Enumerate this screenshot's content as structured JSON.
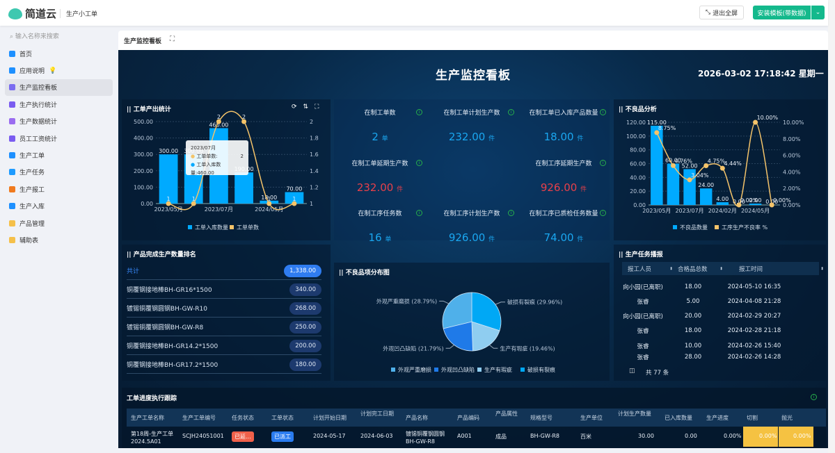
{
  "header": {
    "logo_text": "简道云",
    "app_name": "生产小工单",
    "exit_fullscreen": "退出全屏",
    "install_template": "安装模板(带数据)"
  },
  "sidebar": {
    "search_placeholder": "输入名称来搜索",
    "items": [
      {
        "label": "首页",
        "icon": "home-icon",
        "color": "#1e90ff"
      },
      {
        "label": "应用说明",
        "icon": "doc-icon",
        "color": "#1e90ff"
      },
      {
        "label": "生产监控看板",
        "icon": "home-icon",
        "color": "#7a6cf0",
        "active": true
      },
      {
        "label": "生产执行统计",
        "icon": "chart-icon",
        "color": "#7a5cf0"
      },
      {
        "label": "生产数据统计",
        "icon": "chart-icon",
        "color": "#9a6cf0"
      },
      {
        "label": "员工工资统计",
        "icon": "home-icon",
        "color": "#7a5cf0"
      },
      {
        "label": "生产工单",
        "icon": "doc-icon",
        "color": "#1e90ff"
      },
      {
        "label": "生产任务",
        "icon": "circle-icon",
        "color": "#1e9bff"
      },
      {
        "label": "生产报工",
        "icon": "send-icon",
        "color": "#f07a1e"
      },
      {
        "label": "生产入库",
        "icon": "form-icon",
        "color": "#1e90ff"
      },
      {
        "label": "产品管理",
        "icon": "folder-icon",
        "color": "#f5c04a"
      },
      {
        "label": "辅助表",
        "icon": "folder-icon",
        "color": "#f5c04a"
      }
    ]
  },
  "tab": {
    "label": "生产监控看板"
  },
  "dashboard": {
    "title": "生产监控看板",
    "datetime": "2026-03-02 17:18:42 星期一"
  },
  "chart1_panel": {
    "title": "工单产出统计",
    "tooltip": {
      "title": "2023/07月",
      "line1_label": "工单单数:",
      "line1_value": "2",
      "line2": "工单入库数量:460.00"
    }
  },
  "chart2_panel": {
    "title": "不良品分析"
  },
  "kpis": [
    {
      "label": "在制工单数",
      "value": "2",
      "unit": "单",
      "color": "#1aa7f0"
    },
    {
      "label": "在制工单计划生产数",
      "value": "232.00",
      "unit": "件",
      "color": "#1aa7f0"
    },
    {
      "label": "在制工单已入库产品数量",
      "value": "18.00",
      "unit": "件",
      "color": "#1aa7f0"
    },
    {
      "label": "在制工单延期生产数",
      "value": "232.00",
      "unit": "件",
      "color": "#e8404a"
    },
    {
      "label": "在制工序延期生产数",
      "value": "926.00",
      "unit": "件",
      "color": "#e8404a"
    },
    {
      "label": "在制工序任务数",
      "value": "16",
      "unit": "单",
      "color": "#1aa7f0"
    },
    {
      "label": "在制工序计划生产数",
      "value": "926.00",
      "unit": "件",
      "color": "#1aa7f0"
    },
    {
      "label": "在制工序已质检任务数量",
      "value": "74.00",
      "unit": "件",
      "color": "#1aa7f0"
    }
  ],
  "ranking": {
    "title": "产品完成生产数量排名",
    "total_label": "共计",
    "total_value": "1,338.00",
    "rows": [
      {
        "name": "铜覆钢接地棒BH-GR16*1500",
        "value": "340.00"
      },
      {
        "name": "镀锡铜覆钢圆钢BH-GW-R10",
        "value": "268.00"
      },
      {
        "name": "镀锡铜覆钢圆钢BH-GW-R8",
        "value": "250.00"
      },
      {
        "name": "铜覆钢接地棒BH-GR14.2*1500",
        "value": "200.00"
      },
      {
        "name": "铜覆钢接地棒BH-GR17.2*1500",
        "value": "180.00"
      }
    ]
  },
  "report": {
    "title": "生产任务播报",
    "columns": [
      "报工人员",
      "合格品总数",
      "报工时间"
    ],
    "rows": [
      [
        "向小园(已离职)",
        "18.00",
        "2024-05-10 16:35"
      ],
      [
        "张睿",
        "5.00",
        "2024-04-08 21:28"
      ],
      [
        "向小园(已离职)",
        "20.00",
        "2024-02-29 20:27"
      ],
      [
        "张睿",
        "18.00",
        "2024-02-28 21:18"
      ],
      [
        "张睿",
        "10.00",
        "2024-02-26 15:40"
      ],
      [
        "张睿",
        "28.00",
        "2024-02-26 14:28"
      ]
    ],
    "total": "共 77 条"
  },
  "table": {
    "title": "工单进度执行跟踪",
    "columns": [
      "生产工单名称",
      "生产工单编号",
      "任务状态",
      "工单状态",
      "计划开始日期",
      "计划完工日期",
      "产品名称",
      "产品编码",
      "产品属性",
      "规格型号",
      "生产单位",
      "计划生产数量",
      "已入库数量",
      "生产进度",
      "切割",
      "抛光"
    ],
    "row": {
      "name1": "第18周-生产工单",
      "name2": "2024.5A01",
      "code": "SCJH24051001",
      "task_status": "已延...",
      "order_status": "已派工",
      "start": "2024-05-17",
      "end": "2024-06-03",
      "product1": "镀锡铜覆钢圆钢",
      "product2": "BH-GW-R8",
      "product_code": "A001",
      "attr": "成品",
      "spec": "BH-GW-R8",
      "unit": "百米",
      "plan_qty": "30.00",
      "stored_qty": "0.00",
      "progress": "0.00%",
      "cut": "0.00%",
      "polish": "0.00%"
    },
    "status_colors": {
      "delayed": "#f0604a",
      "dispatched": "#2a7cf0"
    }
  },
  "chart_data": [
    {
      "type": "bar+line",
      "title": "工单产出统计",
      "categories": [
        "2023/05月",
        "",
        "2023/07月",
        "",
        "2024/05月",
        ""
      ],
      "series": [
        {
          "name": "工单入库数量",
          "type": "bar",
          "axis": "left",
          "values": [
            300,
            300,
            460,
            190,
            18,
            70
          ],
          "color": "#00aaff"
        },
        {
          "name": "工单单数",
          "type": "line",
          "axis": "right",
          "values": [
            1,
            1,
            2,
            2,
            1,
            1
          ],
          "color": "#f5c46a"
        }
      ],
      "ylim_left": [
        0,
        500
      ],
      "yticks_left": [
        "0.00",
        "100.00",
        "200.00",
        "300.00",
        "400.00",
        "500.00"
      ],
      "ylim_right": [
        1,
        2
      ],
      "yticks_right": [
        "1",
        "1.2",
        "1.4",
        "1.6",
        "1.8",
        "2"
      ],
      "legend": "bottom",
      "grid": true
    },
    {
      "type": "bar+line",
      "title": "不良品分析",
      "categories": [
        "2023/05月",
        "",
        "2023/07月",
        "",
        "2024/02月",
        "",
        "2024/05月",
        ""
      ],
      "series": [
        {
          "name": "不良品数量",
          "type": "bar",
          "axis": "left",
          "values": [
            115,
            60,
            52,
            24,
            4,
            0,
            2,
            0
          ],
          "color": "#00aaff"
        },
        {
          "name": "工序生产不良率 %",
          "type": "line",
          "axis": "right",
          "values": [
            8.75,
            4.76,
            3.04,
            4.75,
            4.44,
            0,
            10,
            0
          ],
          "color": "#f5c46a"
        }
      ],
      "ylim_left": [
        0,
        120
      ],
      "yticks_left": [
        "0.00",
        "20.00",
        "40.00",
        "60.00",
        "80.00",
        "100.00",
        "120.00"
      ],
      "ylim_right": [
        0,
        10
      ],
      "yticks_right": [
        "0.00%",
        "2.00%",
        "4.00%",
        "6.00%",
        "8.00%",
        "10.00%"
      ],
      "legend": "bottom",
      "grid": true
    },
    {
      "type": "pie",
      "title": "不良品项分布图",
      "slices": [
        {
          "name": "破损有裂痕",
          "value": 29.96,
          "color": "#00a8f5"
        },
        {
          "name": "生产有瑕疵",
          "value": 19.46,
          "color": "#8fcdf0"
        },
        {
          "name": "外观凹凸缺陷",
          "value": 21.79,
          "color": "#1f7ae8"
        },
        {
          "name": "外观严重磨损",
          "value": 28.79,
          "color": "#4fb0ea"
        }
      ],
      "legend_order": [
        "外观严重磨损",
        "外观凹凸缺陷",
        "生产有瑕疵",
        "破损有裂痕"
      ],
      "legend": "bottom"
    }
  ]
}
